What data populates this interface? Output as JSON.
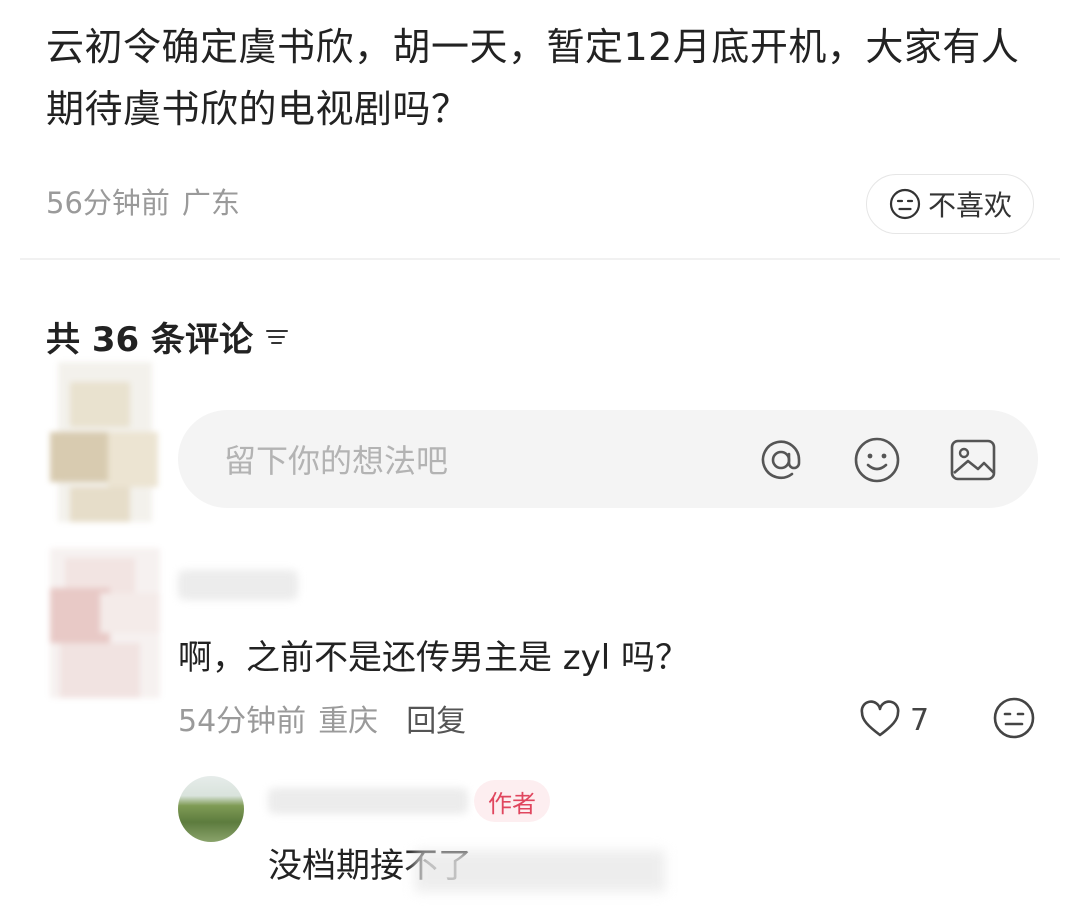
{
  "post": {
    "title": "云初令确定虞书欣，胡一天，暂定12月底开机，大家有人期待虞书欣的电视剧吗？",
    "time": "56分钟前",
    "location": "广东",
    "dislike_label": "不喜欢"
  },
  "comments_header": {
    "label": "共 36 条评论"
  },
  "comment_input": {
    "placeholder": "留下你的想法吧",
    "icons": [
      "at-icon",
      "emoji-icon",
      "image-icon"
    ]
  },
  "comment": {
    "text": "啊，之前不是还传男主是 zyl 吗？",
    "time": "54分钟前",
    "location": "重庆",
    "reply_label": "回复",
    "likes": "7"
  },
  "reply": {
    "badge": "作者",
    "text": "没档期接不了"
  },
  "colors": {
    "badge_text": "#e0465e",
    "badge_bg": "#fdeef0",
    "meta_gray": "#9a9a9a"
  }
}
